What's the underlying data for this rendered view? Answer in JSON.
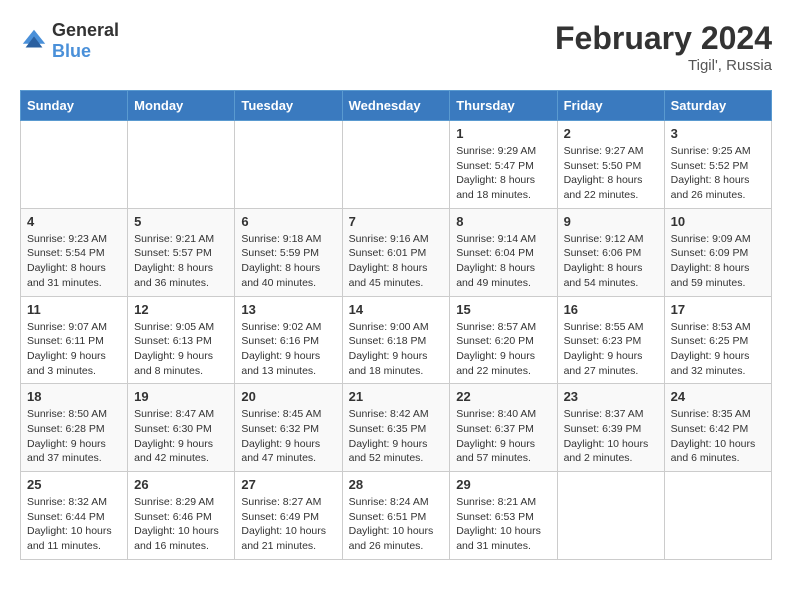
{
  "logo": {
    "text_general": "General",
    "text_blue": "Blue"
  },
  "header": {
    "month_year": "February 2024",
    "location": "Tigil', Russia"
  },
  "weekdays": [
    "Sunday",
    "Monday",
    "Tuesday",
    "Wednesday",
    "Thursday",
    "Friday",
    "Saturday"
  ],
  "weeks": [
    [
      {
        "day": "",
        "detail": ""
      },
      {
        "day": "",
        "detail": ""
      },
      {
        "day": "",
        "detail": ""
      },
      {
        "day": "",
        "detail": ""
      },
      {
        "day": "1",
        "detail": "Sunrise: 9:29 AM\nSunset: 5:47 PM\nDaylight: 8 hours\nand 18 minutes."
      },
      {
        "day": "2",
        "detail": "Sunrise: 9:27 AM\nSunset: 5:50 PM\nDaylight: 8 hours\nand 22 minutes."
      },
      {
        "day": "3",
        "detail": "Sunrise: 9:25 AM\nSunset: 5:52 PM\nDaylight: 8 hours\nand 26 minutes."
      }
    ],
    [
      {
        "day": "4",
        "detail": "Sunrise: 9:23 AM\nSunset: 5:54 PM\nDaylight: 8 hours\nand 31 minutes."
      },
      {
        "day": "5",
        "detail": "Sunrise: 9:21 AM\nSunset: 5:57 PM\nDaylight: 8 hours\nand 36 minutes."
      },
      {
        "day": "6",
        "detail": "Sunrise: 9:18 AM\nSunset: 5:59 PM\nDaylight: 8 hours\nand 40 minutes."
      },
      {
        "day": "7",
        "detail": "Sunrise: 9:16 AM\nSunset: 6:01 PM\nDaylight: 8 hours\nand 45 minutes."
      },
      {
        "day": "8",
        "detail": "Sunrise: 9:14 AM\nSunset: 6:04 PM\nDaylight: 8 hours\nand 49 minutes."
      },
      {
        "day": "9",
        "detail": "Sunrise: 9:12 AM\nSunset: 6:06 PM\nDaylight: 8 hours\nand 54 minutes."
      },
      {
        "day": "10",
        "detail": "Sunrise: 9:09 AM\nSunset: 6:09 PM\nDaylight: 8 hours\nand 59 minutes."
      }
    ],
    [
      {
        "day": "11",
        "detail": "Sunrise: 9:07 AM\nSunset: 6:11 PM\nDaylight: 9 hours\nand 3 minutes."
      },
      {
        "day": "12",
        "detail": "Sunrise: 9:05 AM\nSunset: 6:13 PM\nDaylight: 9 hours\nand 8 minutes."
      },
      {
        "day": "13",
        "detail": "Sunrise: 9:02 AM\nSunset: 6:16 PM\nDaylight: 9 hours\nand 13 minutes."
      },
      {
        "day": "14",
        "detail": "Sunrise: 9:00 AM\nSunset: 6:18 PM\nDaylight: 9 hours\nand 18 minutes."
      },
      {
        "day": "15",
        "detail": "Sunrise: 8:57 AM\nSunset: 6:20 PM\nDaylight: 9 hours\nand 22 minutes."
      },
      {
        "day": "16",
        "detail": "Sunrise: 8:55 AM\nSunset: 6:23 PM\nDaylight: 9 hours\nand 27 minutes."
      },
      {
        "day": "17",
        "detail": "Sunrise: 8:53 AM\nSunset: 6:25 PM\nDaylight: 9 hours\nand 32 minutes."
      }
    ],
    [
      {
        "day": "18",
        "detail": "Sunrise: 8:50 AM\nSunset: 6:28 PM\nDaylight: 9 hours\nand 37 minutes."
      },
      {
        "day": "19",
        "detail": "Sunrise: 8:47 AM\nSunset: 6:30 PM\nDaylight: 9 hours\nand 42 minutes."
      },
      {
        "day": "20",
        "detail": "Sunrise: 8:45 AM\nSunset: 6:32 PM\nDaylight: 9 hours\nand 47 minutes."
      },
      {
        "day": "21",
        "detail": "Sunrise: 8:42 AM\nSunset: 6:35 PM\nDaylight: 9 hours\nand 52 minutes."
      },
      {
        "day": "22",
        "detail": "Sunrise: 8:40 AM\nSunset: 6:37 PM\nDaylight: 9 hours\nand 57 minutes."
      },
      {
        "day": "23",
        "detail": "Sunrise: 8:37 AM\nSunset: 6:39 PM\nDaylight: 10 hours\nand 2 minutes."
      },
      {
        "day": "24",
        "detail": "Sunrise: 8:35 AM\nSunset: 6:42 PM\nDaylight: 10 hours\nand 6 minutes."
      }
    ],
    [
      {
        "day": "25",
        "detail": "Sunrise: 8:32 AM\nSunset: 6:44 PM\nDaylight: 10 hours\nand 11 minutes."
      },
      {
        "day": "26",
        "detail": "Sunrise: 8:29 AM\nSunset: 6:46 PM\nDaylight: 10 hours\nand 16 minutes."
      },
      {
        "day": "27",
        "detail": "Sunrise: 8:27 AM\nSunset: 6:49 PM\nDaylight: 10 hours\nand 21 minutes."
      },
      {
        "day": "28",
        "detail": "Sunrise: 8:24 AM\nSunset: 6:51 PM\nDaylight: 10 hours\nand 26 minutes."
      },
      {
        "day": "29",
        "detail": "Sunrise: 8:21 AM\nSunset: 6:53 PM\nDaylight: 10 hours\nand 31 minutes."
      },
      {
        "day": "",
        "detail": ""
      },
      {
        "day": "",
        "detail": ""
      }
    ]
  ]
}
